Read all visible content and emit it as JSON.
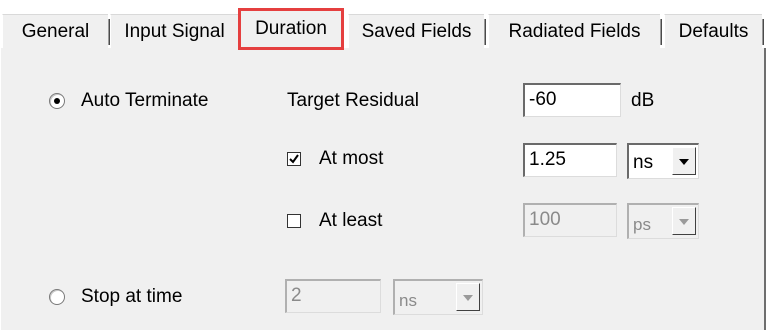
{
  "tabs": [
    {
      "label": "General"
    },
    {
      "label": "Input Signal"
    },
    {
      "label": "Duration",
      "selected": true
    },
    {
      "label": "Saved Fields"
    },
    {
      "label": "Radiated Fields"
    },
    {
      "label": "Defaults"
    }
  ],
  "duration": {
    "auto_terminate": {
      "label": "Auto Terminate",
      "checked": true
    },
    "target_residual": {
      "label": "Target Residual",
      "value": "-60",
      "unit": "dB"
    },
    "at_most": {
      "label": "At most",
      "checked": true,
      "value": "1.25",
      "unit": "ns"
    },
    "at_least": {
      "label": "At least",
      "checked": false,
      "value": "100",
      "unit": "ps"
    },
    "stop_at_time": {
      "label": "Stop at time",
      "checked": false,
      "value": "2",
      "unit": "ns"
    }
  },
  "colors": {
    "highlight_border": "#e53f3f",
    "panel_bg": "#f0f0f0"
  }
}
